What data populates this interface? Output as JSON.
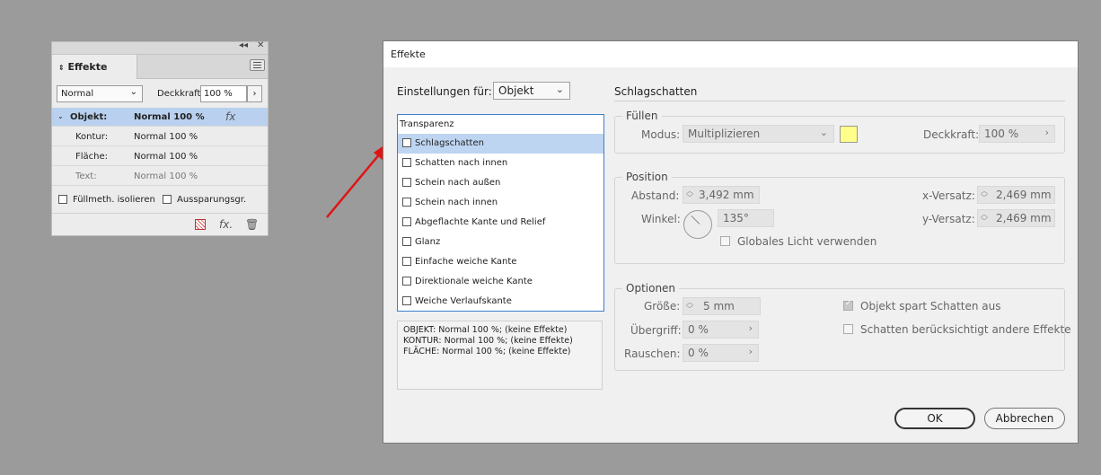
{
  "panel": {
    "tab_label": "Effekte",
    "mode_select": "Normal",
    "opacity_label": "Deckkraft:",
    "opacity_value": "100 %",
    "rows": [
      {
        "label": "Objekt:",
        "value": "Normal 100 %"
      },
      {
        "label": "Kontur:",
        "value": "Normal 100 %"
      },
      {
        "label": "Fläche:",
        "value": "Normal 100 %"
      },
      {
        "label": "Text:",
        "value": "Normal 100 %"
      }
    ],
    "fx_label": "fx",
    "isolate_label": "Füllmeth. isolieren",
    "knockout_label": "Aussparungsgr.",
    "footer_fx": "fx."
  },
  "dialog": {
    "title": "Effekte",
    "settings_for_label": "Einstellungen für:",
    "settings_for_value": "Objekt",
    "effects": [
      {
        "label": "Transparenz",
        "checkbox": false
      },
      {
        "label": "Schlagschatten",
        "checkbox": true
      },
      {
        "label": "Schatten nach innen",
        "checkbox": true
      },
      {
        "label": "Schein nach außen",
        "checkbox": true
      },
      {
        "label": "Schein nach innen",
        "checkbox": true
      },
      {
        "label": "Abgeflachte Kante und Relief",
        "checkbox": true
      },
      {
        "label": "Glanz",
        "checkbox": true
      },
      {
        "label": "Einfache weiche Kante",
        "checkbox": true
      },
      {
        "label": "Direktionale weiche Kante",
        "checkbox": true
      },
      {
        "label": "Weiche Verlaufskante",
        "checkbox": true
      }
    ],
    "summary": [
      "OBJEKT: Normal 100 %; (keine Effekte)",
      "KONTUR: Normal 100 %; (keine Effekte)",
      "FLÄCHE: Normal 100 %; (keine Effekte)"
    ],
    "section_title": "Schlagschatten",
    "fill": {
      "title": "Füllen",
      "mode_label": "Modus:",
      "mode_value": "Multiplizieren",
      "swatch_color": "#ffff8a",
      "opacity_label": "Deckkraft:",
      "opacity_value": "100 %"
    },
    "position": {
      "title": "Position",
      "distance_label": "Abstand:",
      "distance_value": "3,492 mm",
      "angle_label": "Winkel:",
      "angle_value": "135°",
      "global_light_label": "Globales Licht verwenden",
      "x_offset_label": "x-Versatz:",
      "x_offset_value": "2,469 mm",
      "y_offset_label": "y-Versatz:",
      "y_offset_value": "2,469 mm"
    },
    "options": {
      "title": "Optionen",
      "size_label": "Größe:",
      "size_value": "5 mm",
      "spread_label": "Übergriff:",
      "spread_value": "0 %",
      "noise_label": "Rauschen:",
      "noise_value": "0 %",
      "knocks_out_label": "Objekt spart Schatten aus",
      "honors_label": "Schatten berücksichtigt andere Effekte"
    },
    "ok_label": "OK",
    "cancel_label": "Abbrechen"
  }
}
